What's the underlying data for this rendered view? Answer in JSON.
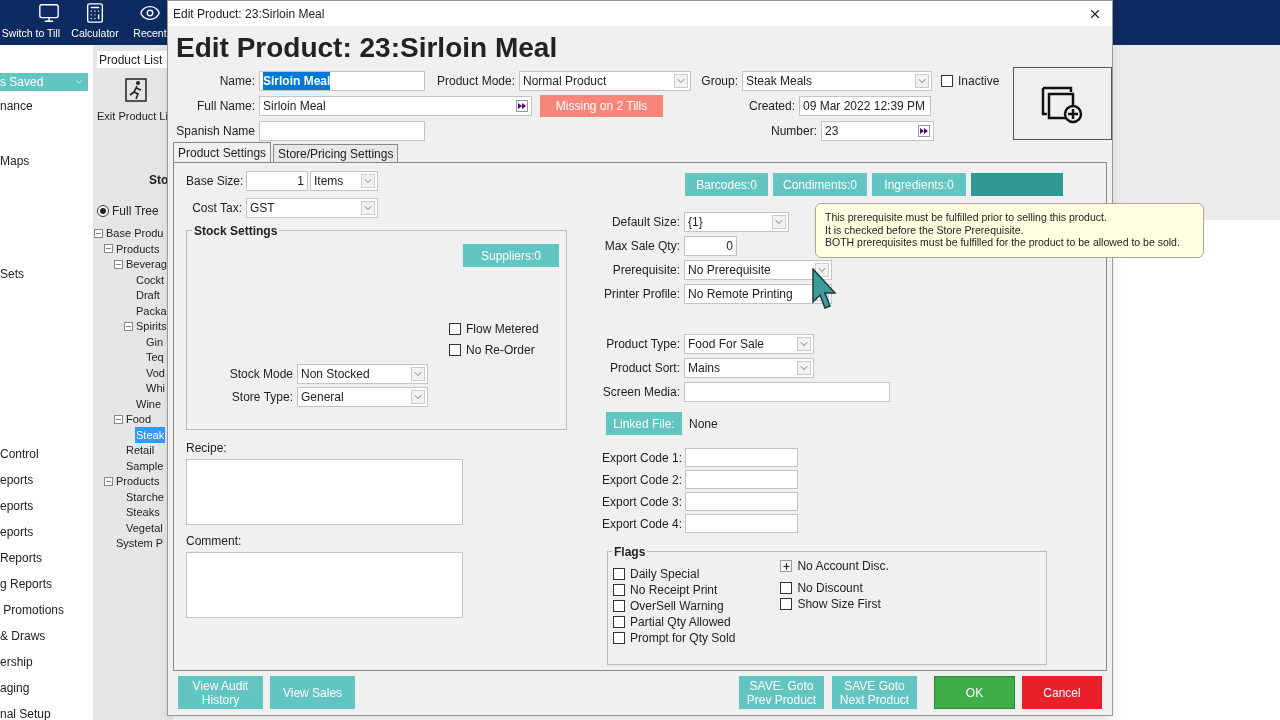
{
  "background": {
    "toolbar": [
      {
        "label": "Switch to Till",
        "kind": "till"
      },
      {
        "label": "Calculator",
        "kind": "calculator"
      },
      {
        "label": "Recent",
        "kind": "recent"
      }
    ],
    "sidebar": {
      "dropdown": "s Saved",
      "items": [
        "nance",
        "Maps",
        "Sets",
        "Control",
        "eports",
        "eports",
        "eports",
        "Reports",
        "g Reports",
        " Promotions",
        "& Draws",
        "ership",
        "aging",
        "nal Setup"
      ]
    },
    "product_list": {
      "tab": "Product List",
      "exit_button": "Exit Product Li",
      "heading": "Sto",
      "view_options": [
        {
          "label": "Full Tree",
          "selected": true
        }
      ],
      "tree": [
        {
          "label": "Base Produ",
          "expanded": true,
          "selected": false,
          "children": [
            {
              "label": "Products",
              "expanded": true,
              "selected": false,
              "children": [
                {
                  "label": "Beverag",
                  "expanded": true,
                  "selected": false,
                  "children": [
                    {
                      "label": "Cockt",
                      "selected": false
                    },
                    {
                      "label": "Draft",
                      "selected": false
                    },
                    {
                      "label": "Packa",
                      "selected": false
                    },
                    {
                      "label": "Spirits",
                      "expanded": true,
                      "selected": false,
                      "children": [
                        {
                          "label": "Gin",
                          "selected": false
                        },
                        {
                          "label": "Teq",
                          "selected": false
                        },
                        {
                          "label": "Vod",
                          "selected": false
                        },
                        {
                          "label": "Whi",
                          "selected": false
                        }
                      ]
                    },
                    {
                      "label": "Wine",
                      "selected": false
                    }
                  ]
                },
                {
                  "label": "Food",
                  "expanded": true,
                  "selected": false,
                  "children": [
                    {
                      "label": "Steak",
                      "selected": true
                    }
                  ]
                },
                {
                  "label": "Retail",
                  "selected": false
                },
                {
                  "label": "Sample",
                  "selected": false
                }
              ]
            },
            {
              "label": "Products",
              "expanded": true,
              "selected": false,
              "children": [
                {
                  "label": "Starche",
                  "selected": false
                },
                {
                  "label": "Steaks",
                  "selected": false
                },
                {
                  "label": "Vegetal",
                  "selected": false
                }
              ]
            },
            {
              "label": "System P",
              "selected": false
            }
          ]
        }
      ]
    }
  },
  "dialog": {
    "title": "Edit Product: 23:Sirloin Meal",
    "heading": "Edit Product: 23:Sirloin Meal",
    "name": {
      "label": "Name:",
      "value": "Sirloin Meal",
      "highlighted": true
    },
    "full_name": {
      "label": "Full Name:",
      "value": "Sirloin Meal"
    },
    "spanish_name": {
      "label": "Spanish Name"
    },
    "product_mode": {
      "label": "Product Mode:",
      "value": "Normal Product"
    },
    "missing_badge": "Missing on 2 Tills",
    "group": {
      "label": "Group:",
      "value": "Steak Meals"
    },
    "created": {
      "label": "Created:",
      "value": "09 Mar 2022 12:39 PM"
    },
    "number": {
      "label": "Number:",
      "value": "23"
    },
    "inactive": {
      "label": "Inactive",
      "checked": false
    },
    "tabs": [
      {
        "label": "Product Settings",
        "selected": true
      },
      {
        "label": "Store/Pricing Settings",
        "selected": false
      }
    ],
    "base_size": {
      "label": "Base Size:",
      "value": "1",
      "unit": "Items"
    },
    "cost_tax": {
      "label": "Cost Tax:",
      "value": "GST"
    },
    "stock_settings": {
      "title": "Stock Settings",
      "suppliers_button": "Suppliers:0",
      "options": [
        {
          "label": "Flow Metered",
          "checked": false
        },
        {
          "label": "No Re-Order",
          "checked": false
        }
      ],
      "stock_mode": {
        "label": "Stock Mode",
        "value": "Non Stocked"
      },
      "store_type": {
        "label": "Store Type:",
        "value": "General"
      }
    },
    "recipe": {
      "label": "Recipe:"
    },
    "comment": {
      "label": "Comment:"
    },
    "count_buttons": [
      {
        "label": "Barcodes:0",
        "highlighted": false
      },
      {
        "label": "Condiments:0",
        "highlighted": false
      },
      {
        "label": "Ingredients:0",
        "highlighted": false
      },
      {
        "highlighted": true
      }
    ],
    "default_size": {
      "label": "Default Size:",
      "value": "{1}"
    },
    "max_sale_qty": {
      "label": "Max Sale Qty:",
      "value": "0"
    },
    "prerequisite": {
      "label": "Prerequisite:",
      "value": "No Prerequisite"
    },
    "printer_profile": {
      "label": "Printer Profile:",
      "value": "No Remote Printing"
    },
    "product_type": {
      "label": "Product Type:",
      "value": "Food For Sale"
    },
    "product_sort": {
      "label": "Product Sort:",
      "value": "Mains"
    },
    "screen_media": {
      "label": "Screen Media:"
    },
    "linked_file": {
      "button": "Linked File:",
      "value": "None"
    },
    "export_codes": [
      "Export Code 1:",
      "Export Code 2:",
      "Export Code 3:",
      "Export Code 4:"
    ],
    "flags": {
      "title": "Flags",
      "columns": [
        [
          {
            "kind": "checkbox",
            "label": "Daily Special",
            "checked": false
          },
          {
            "kind": "checkbox",
            "label": "No Receipt Print",
            "checked": false
          },
          {
            "kind": "checkbox",
            "label": "OverSell Warning",
            "checked": false
          },
          {
            "kind": "checkbox",
            "label": "Partial Qty Allowed",
            "checked": false
          },
          {
            "kind": "checkbox",
            "label": "Prompt for Qty Sold",
            "checked": false
          }
        ],
        [
          {
            "kind": "expander",
            "label": "No Account Disc."
          },
          {
            "kind": "checkbox",
            "label": "No Discount",
            "checked": false
          },
          {
            "kind": "checkbox",
            "label": "Show Size First",
            "checked": false
          }
        ]
      ]
    },
    "tooltip": [
      "This prerequisite must be fulfilled prior to selling this product.",
      "It is checked before the Store Prerequisite.",
      "BOTH prerequisites must be fulfilled for the product to be allowed to be sold."
    ],
    "left_buttons": [
      "View Audit History",
      "View Sales"
    ],
    "nav_buttons": [
      "SAVE. Goto Prev Product",
      "SAVE Goto Next Product"
    ],
    "ok_button": "OK",
    "cancel_button": "Cancel"
  }
}
